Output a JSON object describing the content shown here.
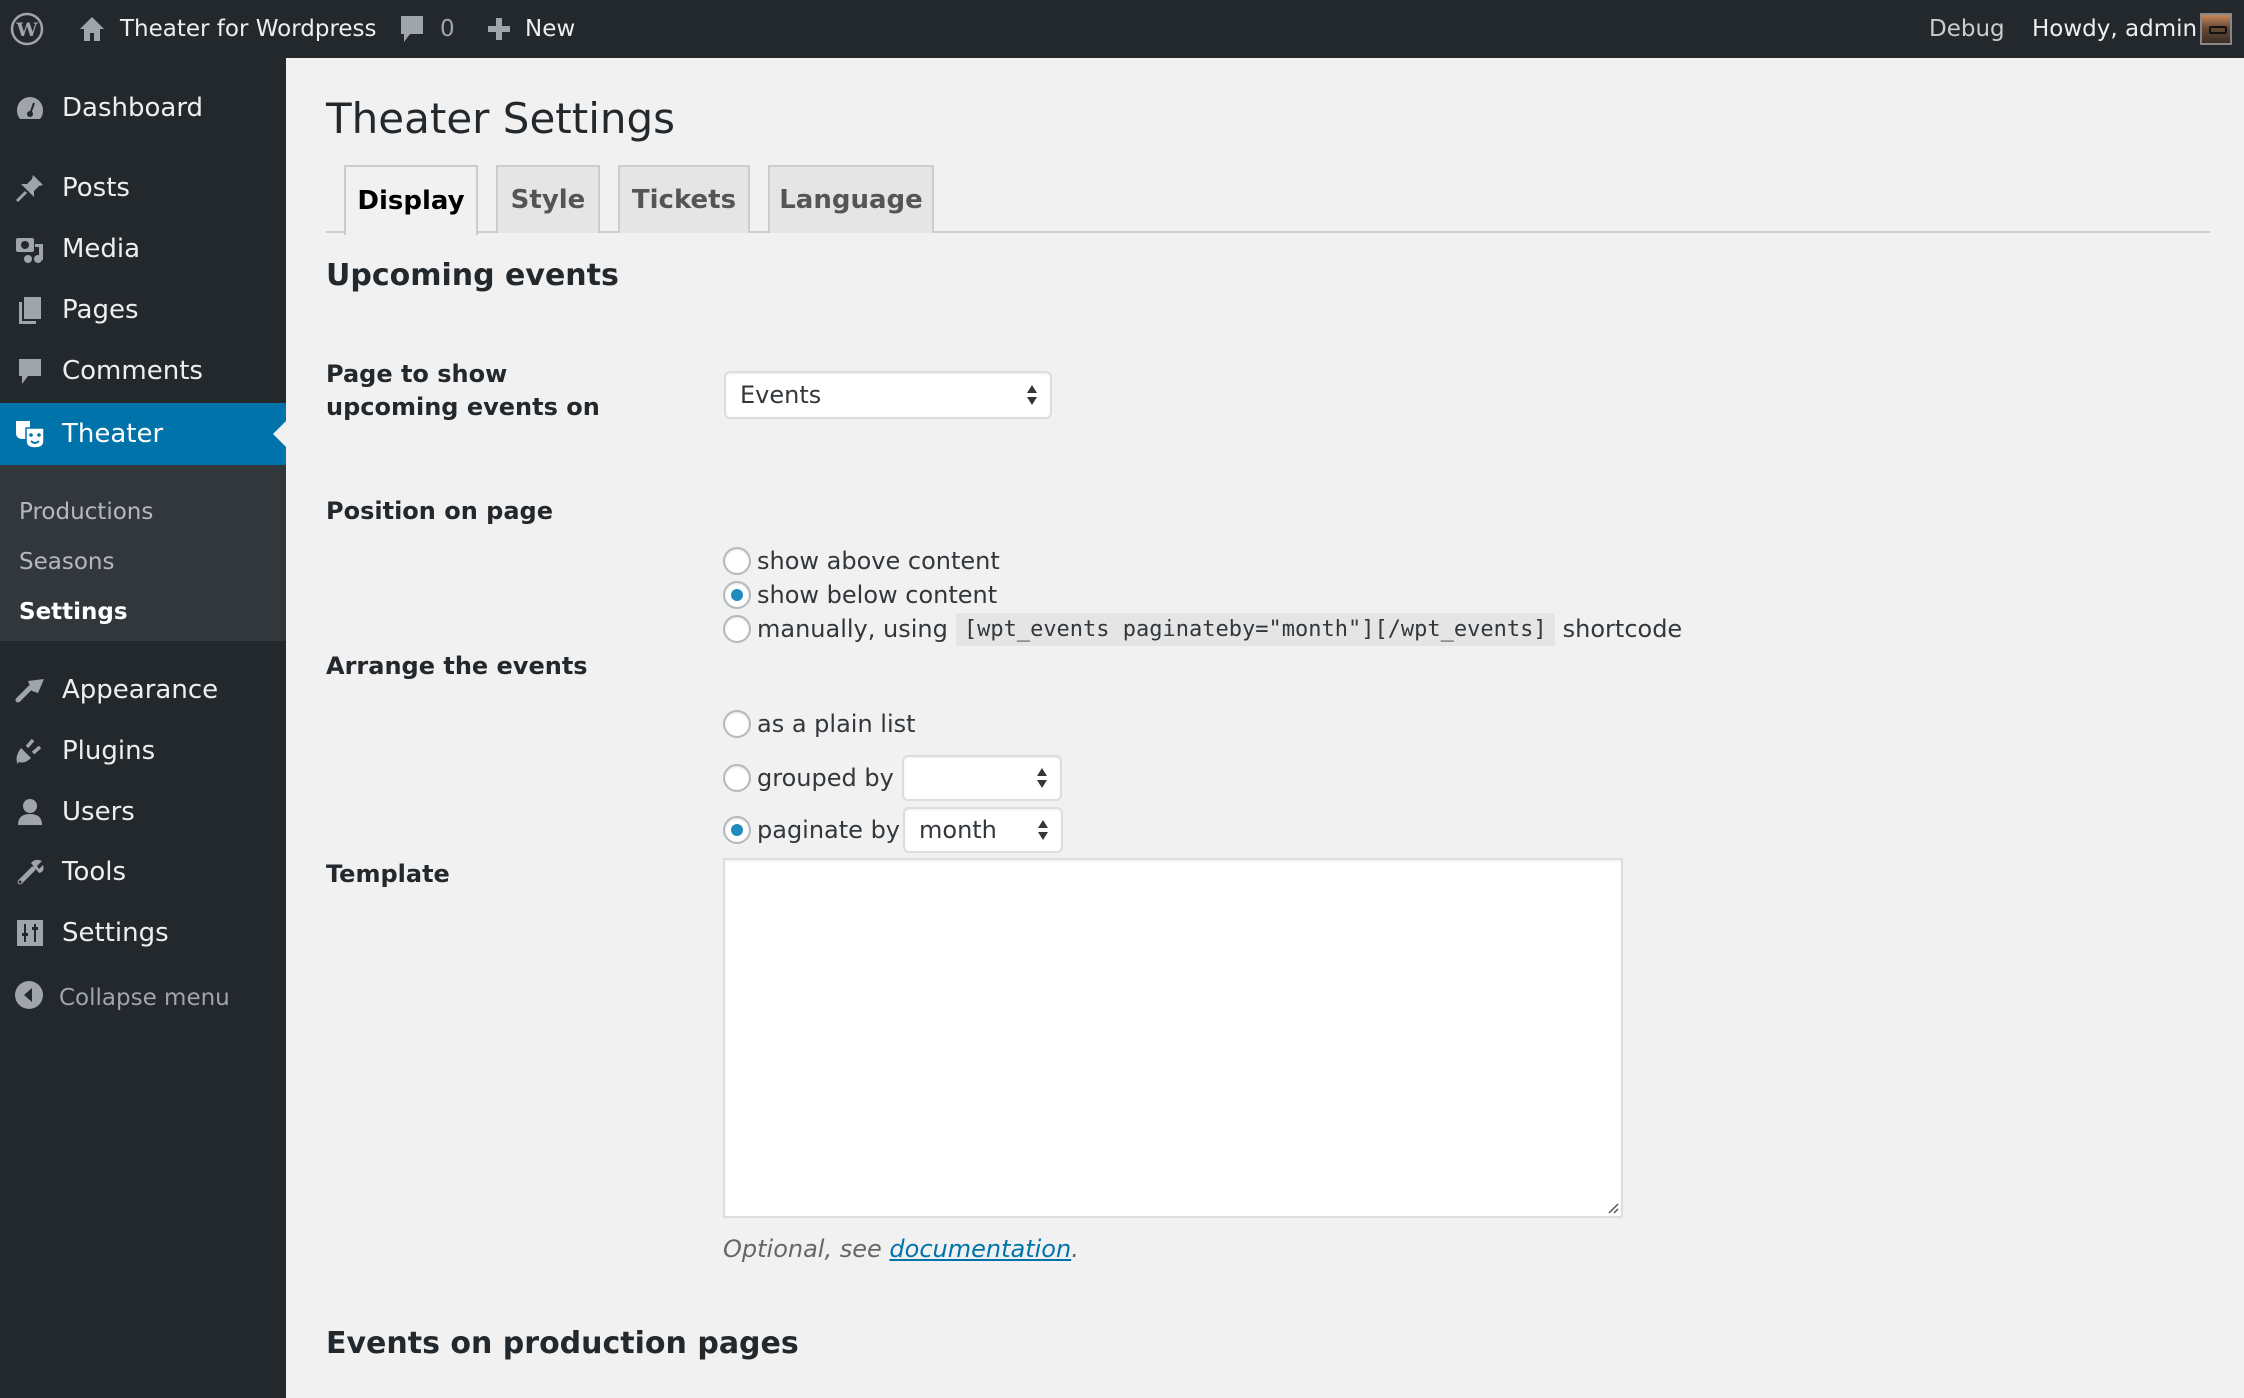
{
  "adminbar": {
    "site_name": "Theater for Wordpress",
    "comments_count": "0",
    "new_label": "New",
    "debug_label": "Debug",
    "howdy_label": "Howdy, admin"
  },
  "sidebar": {
    "items": [
      {
        "label": "Dashboard",
        "icon": "dashboard-icon"
      },
      {
        "label": "Posts",
        "icon": "pushpin-icon"
      },
      {
        "label": "Media",
        "icon": "media-icon"
      },
      {
        "label": "Pages",
        "icon": "pages-icon"
      },
      {
        "label": "Comments",
        "icon": "comment-icon"
      },
      {
        "label": "Theater",
        "icon": "theater-masks-icon",
        "active": true
      },
      {
        "label": "Appearance",
        "icon": "paintbrush-icon"
      },
      {
        "label": "Plugins",
        "icon": "plug-icon"
      },
      {
        "label": "Users",
        "icon": "user-icon"
      },
      {
        "label": "Tools",
        "icon": "wrench-icon"
      },
      {
        "label": "Settings",
        "icon": "settings-sliders-icon"
      }
    ],
    "submenu": [
      {
        "label": "Productions"
      },
      {
        "label": "Seasons"
      },
      {
        "label": "Settings",
        "current": true
      }
    ],
    "collapse_label": "Collapse menu"
  },
  "page": {
    "title": "Theater Settings",
    "tabs": [
      {
        "label": "Display",
        "active": true
      },
      {
        "label": "Style"
      },
      {
        "label": "Tickets"
      },
      {
        "label": "Language"
      }
    ],
    "sections": {
      "upcoming_title": "Upcoming events",
      "production_title": "Events on production pages"
    },
    "fields": {
      "page_label": "Page to show upcoming events on",
      "page_value": "Events",
      "position_label": "Position on page",
      "position_options": [
        {
          "label": "show above content",
          "checked": false
        },
        {
          "label": "show below content",
          "checked": true
        },
        {
          "label_before": "manually, using",
          "code": "[wpt_events paginateby=\"month\"][/wpt_events]",
          "label_after": "shortcode",
          "checked": false
        }
      ],
      "arrange_label": "Arrange the events",
      "arrange_options": [
        {
          "label": "as a plain list",
          "checked": false
        },
        {
          "label": "grouped by",
          "checked": false,
          "select_value": ""
        },
        {
          "label": "paginate by",
          "checked": true,
          "select_value": "month"
        }
      ],
      "template_label": "Template",
      "template_value": "",
      "template_description_prefix": "Optional, see ",
      "template_description_link": "documentation",
      "template_description_suffix": "."
    }
  },
  "colors": {
    "adminbar_bg": "#23282d",
    "sidebar_active": "#0073aa",
    "radio_checked": "#1e8cbe",
    "link": "#0073aa"
  }
}
